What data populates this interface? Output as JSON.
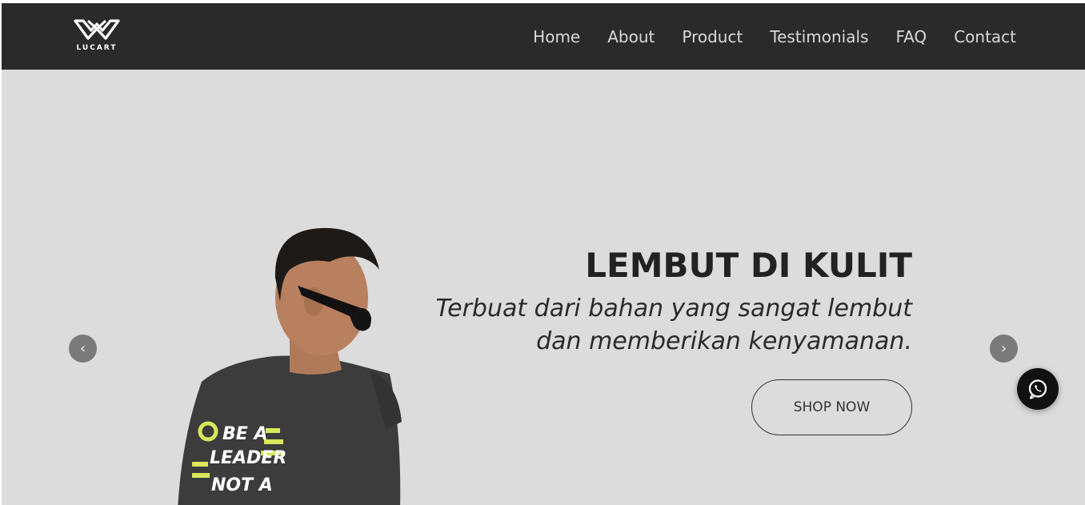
{
  "brand": {
    "logo_text": "LUCART"
  },
  "nav": {
    "items": [
      {
        "label": "Home"
      },
      {
        "label": "About"
      },
      {
        "label": "Product"
      },
      {
        "label": "Testimonials"
      },
      {
        "label": "FAQ"
      },
      {
        "label": "Contact"
      }
    ]
  },
  "hero": {
    "headline": "LEMBUT DI KULIT",
    "subtext_line1": "Terbuat dari bahan yang sangat lembut",
    "subtext_line2": "dan memberikan kenyamanan.",
    "cta_label": "SHOP NOW",
    "shirt_print": [
      "BE A",
      "LEADER",
      "NOT A"
    ]
  },
  "carousel": {
    "prev_icon": "chevron-left-icon",
    "next_icon": "chevron-right-icon"
  },
  "floating": {
    "whatsapp_icon": "whatsapp-icon"
  },
  "colors": {
    "navbar": "#2b2a2a",
    "hero_bg": "#dcdcdc",
    "nav_text": "#d9d9d9",
    "headline": "#222222",
    "accent_print": "#d8e85a"
  }
}
